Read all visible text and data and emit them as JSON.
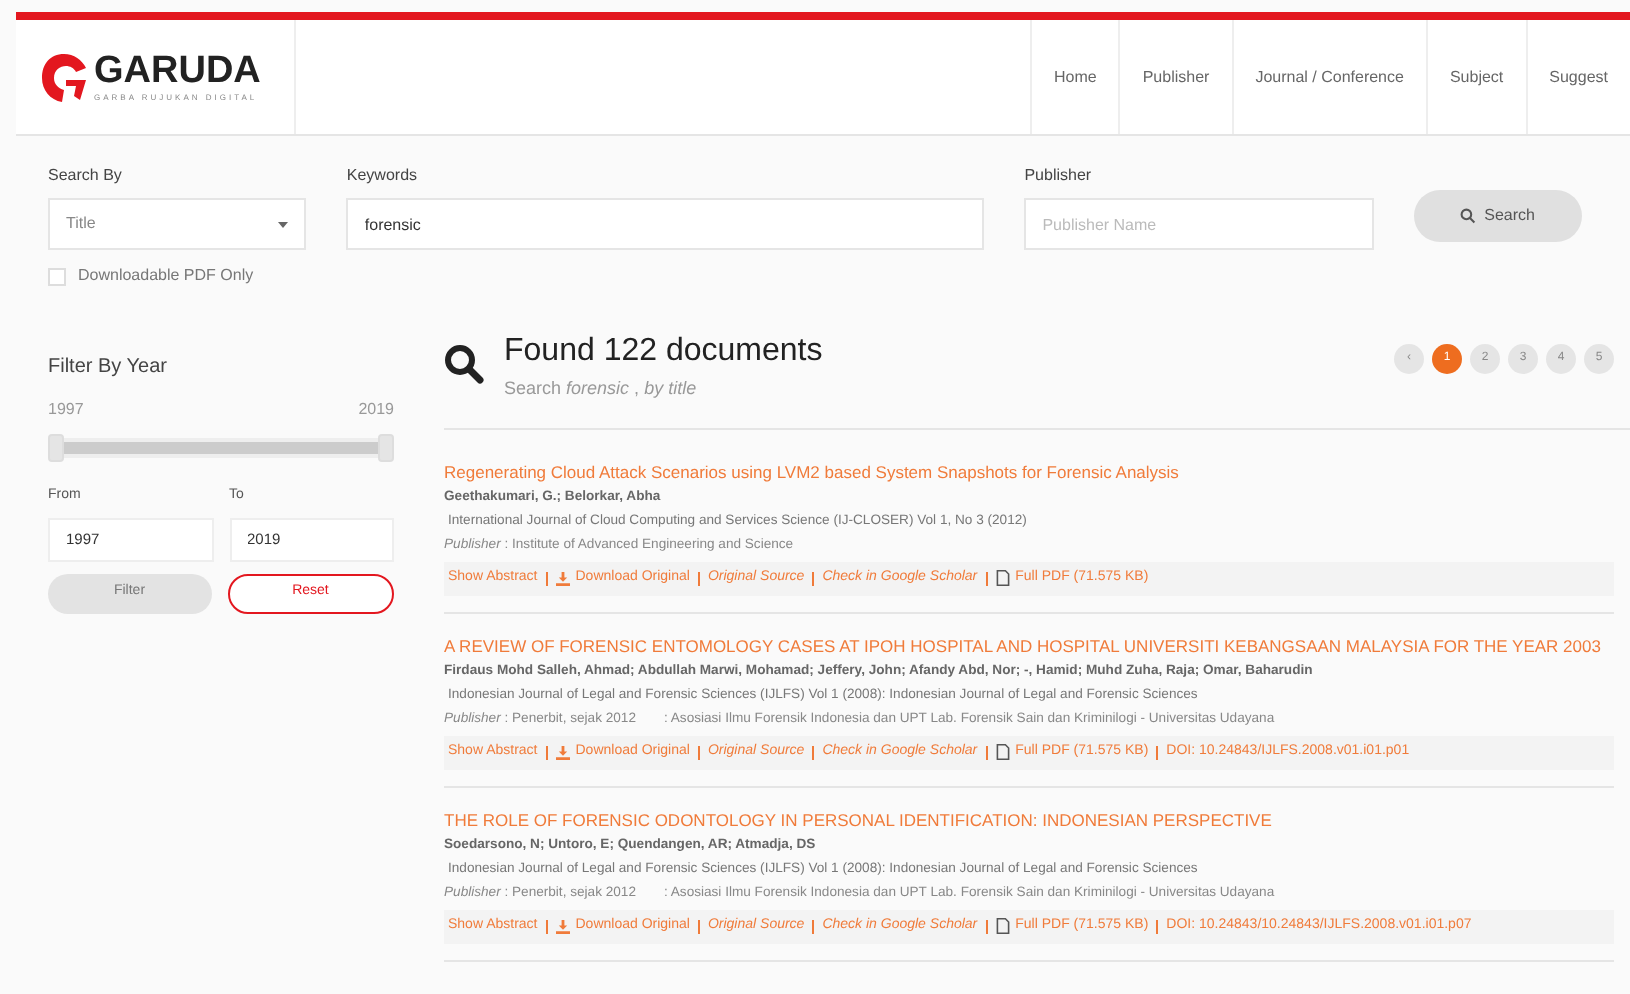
{
  "header": {
    "logo": {
      "name": "GARUDA",
      "tagline": "GARBA RUJUKAN DIGITAL"
    },
    "nav": [
      {
        "label": "Home"
      },
      {
        "label": "Publisher"
      },
      {
        "label": "Journal / Conference"
      },
      {
        "label": "Subject"
      },
      {
        "label": "Suggest"
      }
    ]
  },
  "search": {
    "search_by": {
      "label": "Search By",
      "value": "Title"
    },
    "keywords": {
      "label": "Keywords",
      "value": "forensic"
    },
    "publisher": {
      "label": "Publisher",
      "placeholder": "Publisher Name"
    },
    "button": "Search",
    "pdf_only": {
      "label": "Downloadable PDF Only",
      "checked": false
    }
  },
  "filter": {
    "title": "Filter By Year",
    "min": "1997",
    "max": "2019",
    "slider": {
      "level": 1
    },
    "from": {
      "label": "From",
      "value": "1997"
    },
    "to": {
      "label": "To",
      "value": "2019"
    },
    "filter_button": "Filter",
    "reset_button": "Reset"
  },
  "results": {
    "heading": "Found 122 documents",
    "subtitle": "Search *forensic* , *by title*",
    "pagination": [
      {
        "label": "‹",
        "selected": false
      },
      {
        "label": "1",
        "selected": true
      },
      {
        "label": "2",
        "selected": false
      },
      {
        "label": "3",
        "selected": false
      },
      {
        "label": "4",
        "selected": false
      },
      {
        "label": "5",
        "selected": false
      }
    ],
    "items": [
      {
        "title": "Regenerating Cloud Attack Scenarios using LVM2 based System Snapshots for Forensic Analysis",
        "authors": "Geethakumari, G.; Belorkar, Abha",
        "journal": "International Journal of Cloud Computing and Services Science (IJ-CLOSER)  Vol 1, No 3 (2012)",
        "publisher": "*Publisher* : Institute of Advanced Engineering and Science",
        "links": [
          {
            "kind": "plain",
            "text": "Show Abstract"
          },
          {
            "kind": "download",
            "text": "Download Original"
          },
          {
            "kind": "italic",
            "text": "Original Source"
          },
          {
            "kind": "italic",
            "text": "Check in Google Scholar"
          },
          {
            "kind": "pdf",
            "text": "Full PDF (71.575 KB)"
          }
        ]
      },
      {
        "title": "A REVIEW OF FORENSIC ENTOMOLOGY CASES AT IPOH HOSPITAL AND HOSPITAL UNIVERSITI KEBANGSAAN MALAYSIA FOR THE YEAR 2003",
        "authors": "Firdaus Mohd Salleh, Ahmad; Abdullah Marwi, Mohamad; Jeffery, John; Afandy Abd, Nor; -, Hamid; Muhd Zuha, Raja; Omar, Baharudin",
        "journal": "Indonesian Journal of Legal and Forensic Sciences (IJLFS)  Vol 1 (2008): Indonesian Journal of Legal and Forensic Sciences",
        "publisher": "*Publisher* : Penerbit, sejak 2012",
        "affiliation": ": Asosiasi Ilmu Forensik Indonesia dan UPT Lab. Forensik Sain dan Kriminilogi - Universitas Udayana",
        "links": [
          {
            "kind": "plain",
            "text": "Show Abstract"
          },
          {
            "kind": "download",
            "text": "Download Original"
          },
          {
            "kind": "italic",
            "text": "Original Source"
          },
          {
            "kind": "italic",
            "text": "Check in Google Scholar"
          },
          {
            "kind": "pdf",
            "text": "Full PDF (71.575 KB)"
          },
          {
            "kind": "plain",
            "text": "DOI: 10.24843/IJLFS.2008.v01.i01.p01"
          }
        ]
      },
      {
        "title": "THE ROLE OF FORENSIC ODONTOLOGY IN PERSONAL IDENTIFICATION: INDONESIAN PERSPECTIVE",
        "authors": "Soedarsono, N; Untoro, E; Quendangen, AR; Atmadja, DS",
        "journal": "Indonesian Journal of Legal and Forensic Sciences (IJLFS)  Vol 1 (2008): Indonesian Journal of Legal and Forensic Sciences",
        "publisher": "*Publisher* : Penerbit, sejak 2012",
        "affiliation": ": Asosiasi Ilmu Forensik Indonesia dan UPT Lab. Forensik Sain dan Kriminilogi - Universitas Udayana",
        "links": [
          {
            "kind": "plain",
            "text": "Show Abstract"
          },
          {
            "kind": "download",
            "text": "Download Original"
          },
          {
            "kind": "italic",
            "text": "Original Source"
          },
          {
            "kind": "italic",
            "text": "Check in Google Scholar"
          },
          {
            "kind": "pdf",
            "text": "Full PDF (71.575 KB)"
          },
          {
            "kind": "plain",
            "text": "DOI: 10.24843/10.24843/IJLFS.2008.v01.i01.p07"
          }
        ]
      }
    ]
  }
}
